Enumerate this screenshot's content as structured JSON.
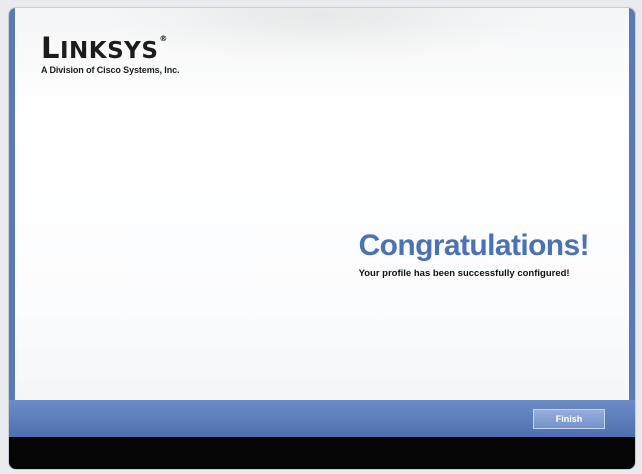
{
  "brand": {
    "wordmark_first": "L",
    "wordmark_rest": "INKSYS",
    "registered_mark": "®",
    "tagline": "A Division of Cisco Systems, Inc."
  },
  "message": {
    "headline": "Congratulations!",
    "subtext": "Your profile has been successfully configured!"
  },
  "footer": {
    "finish_label": "Finish"
  },
  "colors": {
    "headline_blue": "#4a72b4",
    "footer_blue": "#5a7ab7",
    "bottom_bar": "#050505"
  }
}
